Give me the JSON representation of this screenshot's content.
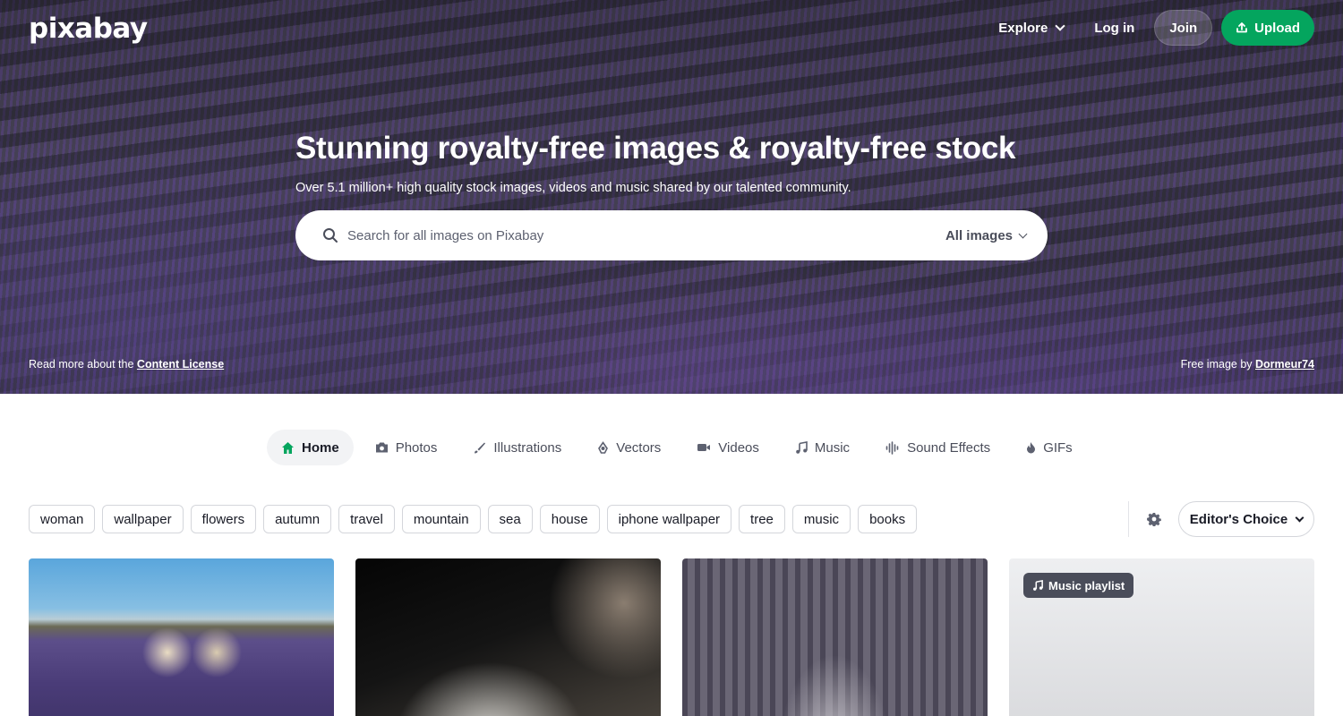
{
  "header": {
    "logo": "pixabay",
    "explore_label": "Explore",
    "login_label": "Log in",
    "join_label": "Join",
    "upload_label": "Upload"
  },
  "hero": {
    "title": "Stunning royalty-free images & royalty-free stock",
    "subtitle": "Over 5.1 million+ high quality stock images, videos and music shared by our talented community.",
    "search_placeholder": "Search for all images on Pixabay",
    "search_type": "All images",
    "license_prefix": "Read more about the ",
    "license_link": "Content License",
    "credit_prefix": "Free image by ",
    "credit_author": "Dormeur74"
  },
  "tabs": [
    {
      "label": "Home",
      "icon": "home-icon",
      "active": true
    },
    {
      "label": "Photos",
      "icon": "camera-icon"
    },
    {
      "label": "Illustrations",
      "icon": "brush-icon"
    },
    {
      "label": "Vectors",
      "icon": "pen-tool-icon"
    },
    {
      "label": "Videos",
      "icon": "video-camera-icon"
    },
    {
      "label": "Music",
      "icon": "music-note-icon"
    },
    {
      "label": "Sound Effects",
      "icon": "waveform-icon"
    },
    {
      "label": "GIFs",
      "icon": "flame-icon"
    }
  ],
  "tags": [
    "woman",
    "wallpaper",
    "flowers",
    "autumn",
    "travel",
    "mountain",
    "sea",
    "house",
    "iphone wallpaper",
    "tree",
    "music",
    "books"
  ],
  "sort": {
    "label": "Editor's Choice"
  },
  "cards": [
    {
      "alt": "two women in hats in lavender field"
    },
    {
      "alt": "white swan close-up"
    },
    {
      "alt": "gothic cathedral interior"
    },
    {
      "badge": "Music playlist"
    }
  ],
  "colors": {
    "accent": "#04a55e",
    "text": "#191b26",
    "muted": "#4a4d5a"
  }
}
